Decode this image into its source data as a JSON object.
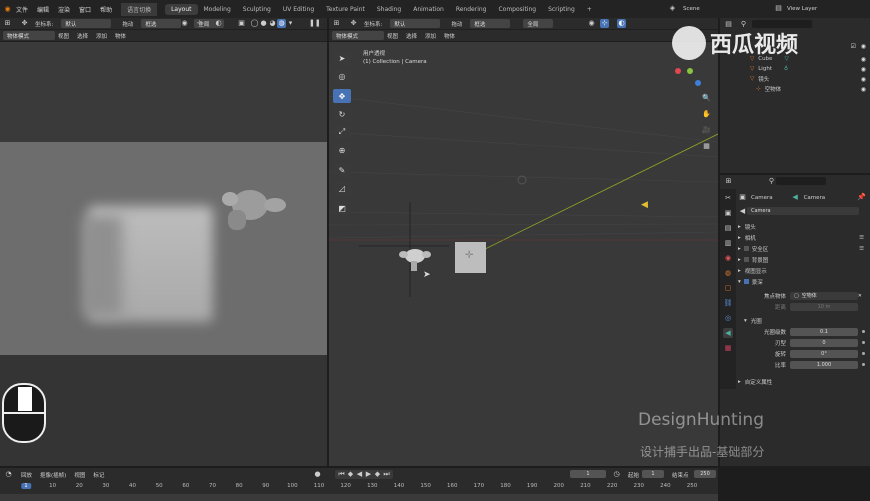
{
  "menus": [
    "文件",
    "编辑",
    "渲染",
    "窗口",
    "帮助"
  ],
  "workspace_group": "语言切换",
  "workspaces": [
    "Layout",
    "Modeling",
    "Sculpting",
    "UV Editing",
    "Texture Paint",
    "Shading",
    "Animation",
    "Rendering",
    "Compositing",
    "Scripting"
  ],
  "active_workspace": "Layout",
  "add_tab": "+",
  "scene": {
    "name": "Scene"
  },
  "view_layer": {
    "name": "View Layer"
  },
  "left_view": {
    "header": {
      "transform_orientation_label": "坐标系:",
      "orientation": "默认",
      "drag_label": "拖动",
      "select": "框选",
      "pivot": "全局",
      "mode": "物体模式",
      "menu": [
        "视图",
        "选择",
        "添加",
        "物体"
      ]
    }
  },
  "main_view": {
    "header": {
      "transform_orientation_label": "坐标系:",
      "orientation": "默认",
      "drag_label": "拖动",
      "select": "框选",
      "pivot": "全局",
      "mode": "物体模式",
      "menu": [
        "视图",
        "选择",
        "添加",
        "物体"
      ]
    },
    "overlay_title": "用户透视",
    "overlay_sub": "(1) Collection | Camera"
  },
  "outliner": {
    "search_placeholder": "",
    "rows": [
      {
        "name": "Cube",
        "icon_color": "#e07a2e",
        "data_color": "#4fb0a0"
      },
      {
        "name": "Light",
        "icon_color": "#e07a2e",
        "data_color": "#4fb0a0"
      },
      {
        "name": "镜头",
        "icon_color": "#e07a2e",
        "data_color": "#4fb0a0"
      },
      {
        "name": "空物体",
        "icon_color": "#e07a2e",
        "data_color": ""
      }
    ]
  },
  "properties": {
    "object_name": "Camera",
    "data_name": "Camera",
    "datablock": "Camera",
    "sections": [
      {
        "label": "镜头",
        "checkbox": false,
        "open": false
      },
      {
        "label": "相机",
        "checkbox": false,
        "open": false
      },
      {
        "label": "安全区",
        "checkbox": true,
        "checked": false,
        "open": false
      },
      {
        "label": "背景图",
        "checkbox": true,
        "checked": false,
        "open": false
      },
      {
        "label": "视图显示",
        "checkbox": false,
        "open": false
      },
      {
        "label": "景深",
        "checkbox": true,
        "checked": true,
        "open": true
      }
    ],
    "dof": {
      "focus_object_label": "焦点物体",
      "focus_object": "空物体",
      "distance_label": "距离",
      "distance": "10 m",
      "aperture_title": "光圈",
      "fstop_label": "光圈级数",
      "fstop": "0.1",
      "blades_label": "刃型",
      "blades": "0",
      "rotation_label": "旋转",
      "rotation": "0°",
      "ratio_label": "比率",
      "ratio": "1.000"
    },
    "custom_props": "自定义属性"
  },
  "timeline": {
    "menu": [
      "回放",
      "抠像(插帧)",
      "视图",
      "标记"
    ],
    "current_frame": "1",
    "start_label": "起始",
    "start": "1",
    "end_label": "结束点",
    "end": "250",
    "ticks": [
      "1",
      "10",
      "20",
      "30",
      "40",
      "50",
      "60",
      "70",
      "80",
      "90",
      "100",
      "110",
      "120",
      "130",
      "140",
      "150",
      "160",
      "170",
      "180",
      "190",
      "200",
      "210",
      "220",
      "230",
      "240",
      "250"
    ]
  },
  "watermark": {
    "brand": "西瓜视频",
    "line1": "DesignHunting",
    "line2": "设计捕手出品-基础部分"
  }
}
